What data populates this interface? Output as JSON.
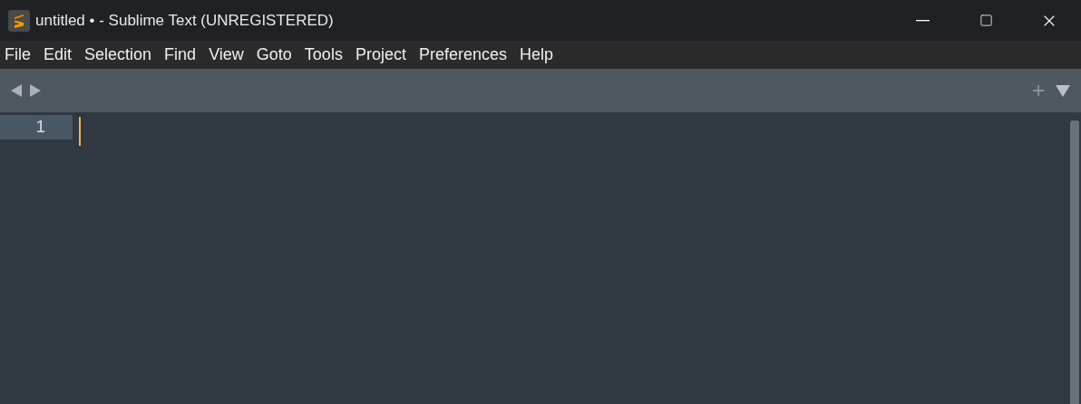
{
  "window": {
    "title": "untitled • - Sublime Text (UNREGISTERED)"
  },
  "menu": [
    "File",
    "Edit",
    "Selection",
    "Find",
    "View",
    "Goto",
    "Tools",
    "Project",
    "Preferences",
    "Help"
  ],
  "editor": {
    "lines": [
      {
        "number": "1",
        "current": true
      }
    ]
  }
}
